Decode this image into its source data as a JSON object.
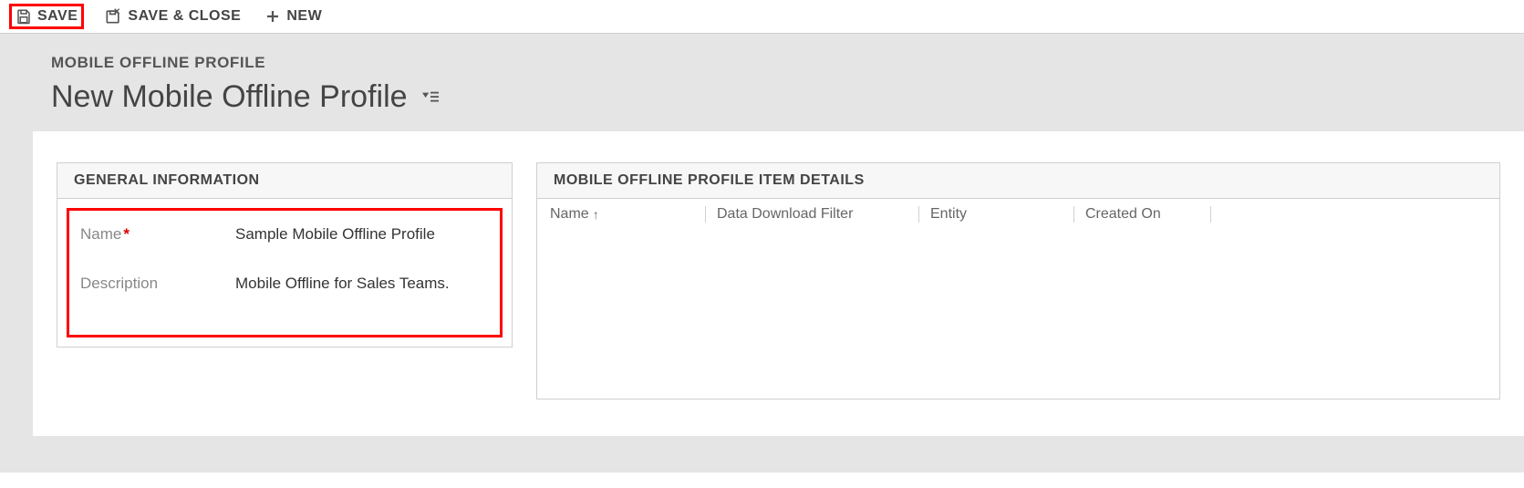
{
  "toolbar": {
    "save_label": "SAVE",
    "save_close_label": "SAVE & CLOSE",
    "new_label": "NEW"
  },
  "header": {
    "breadcrumb": "MOBILE OFFLINE PROFILE",
    "title": "New Mobile Offline Profile"
  },
  "general": {
    "section_title": "GENERAL INFORMATION",
    "name_label": "Name",
    "name_value": "Sample Mobile Offline Profile",
    "description_label": "Description",
    "description_value": "Mobile Offline for Sales Teams."
  },
  "details": {
    "section_title": "MOBILE OFFLINE PROFILE ITEM DETAILS",
    "columns": {
      "name": "Name",
      "filter": "Data Download Filter",
      "entity": "Entity",
      "created": "Created On"
    },
    "sort_column": "name",
    "sort_direction": "asc",
    "rows": []
  },
  "colors": {
    "highlight": "#ff0000"
  }
}
